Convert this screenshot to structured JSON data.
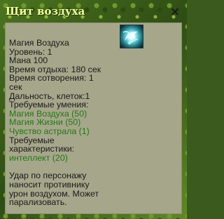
{
  "window": {
    "title": "Щит воздуха",
    "close_label": "×"
  },
  "spell": {
    "icon": "air-shield-icon",
    "school": "Магия Воздуха",
    "level": "Уровень: 1",
    "mana": "Мана 100",
    "rest_time": "Время отдыха: 180 сек",
    "cast_time_line1": "Время сотворения: 1",
    "cast_time_line2": "сек",
    "range": "Дальность, клеток:1",
    "required_skills_label": "Требуемые умения:",
    "required_skills": [
      "Магия Воздуха (50)",
      "Магия Жизни (50)",
      "Чувство астрала (1)"
    ],
    "required_stats_label_line1": "Требуемые",
    "required_stats_label_line2": "характеристики:",
    "required_stats": [
      "интеллект (20)"
    ],
    "description_lines": [
      "Удар по персонажу",
      "наносит противнику",
      "урон воздухом. Может",
      "парализовать."
    ]
  },
  "colors": {
    "title": "#f2ff9a",
    "panel": "#a6a68b",
    "requirement": "#1f7a12",
    "text": "#1a1a1a"
  }
}
